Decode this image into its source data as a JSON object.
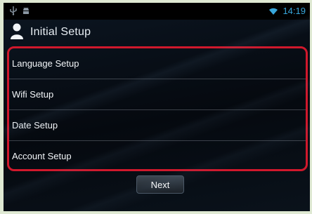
{
  "status_bar": {
    "time": "14:19",
    "icons_left": [
      "usb-icon",
      "android-debug-icon"
    ],
    "icons_right": [
      "wifi-icon"
    ],
    "clock_color": "#38a7dc"
  },
  "header": {
    "title": "Initial Setup",
    "icon": "user-icon"
  },
  "settings": {
    "items": [
      {
        "label": "Language Setup"
      },
      {
        "label": "Wifi Setup"
      },
      {
        "label": "Date Setup"
      },
      {
        "label": "Account Setup"
      }
    ],
    "highlight_color": "#d0182c"
  },
  "footer": {
    "next_label": "Next"
  }
}
